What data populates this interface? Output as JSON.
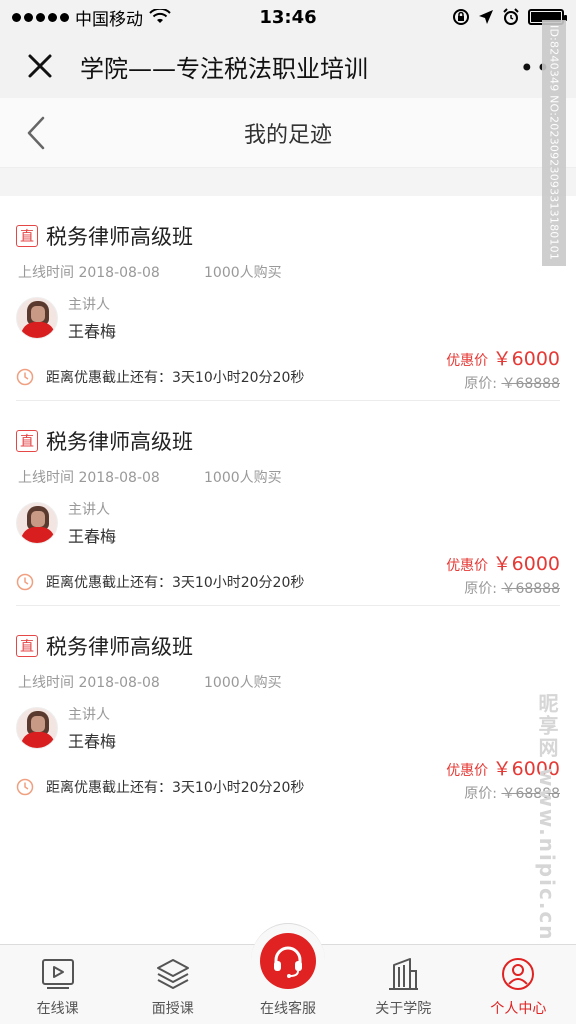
{
  "status_bar": {
    "carrier": "中国移动",
    "time": "13:46"
  },
  "nav": {
    "title": "学院——专注税法职业培训",
    "more": "••"
  },
  "page": {
    "title": "我的足迹"
  },
  "courses": [
    {
      "tag": "直",
      "title": "税务律师高级班",
      "date": "上线时间 2018-08-08",
      "buyers": "1000人购买",
      "teacher_label": "主讲人",
      "teacher_name": "王春梅",
      "sale_label": "优惠价",
      "sale_price": "￥6000",
      "orig_label": "原价:",
      "orig_price": "￥68888",
      "countdown": "距离优惠截止还有：3天10小时20分20秒"
    },
    {
      "tag": "直",
      "title": "税务律师高级班",
      "date": "上线时间 2018-08-08",
      "buyers": "1000人购买",
      "teacher_label": "主讲人",
      "teacher_name": "王春梅",
      "sale_label": "优惠价",
      "sale_price": "￥6000",
      "orig_label": "原价:",
      "orig_price": "￥68888",
      "countdown": "距离优惠截止还有：3天10小时20分20秒"
    },
    {
      "tag": "直",
      "title": "税务律师高级班",
      "date": "上线时间 2018-08-08",
      "buyers": "1000人购买",
      "teacher_label": "主讲人",
      "teacher_name": "王春梅",
      "sale_label": "优惠价",
      "sale_price": "￥6000",
      "orig_label": "原价:",
      "orig_price": "￥68888",
      "countdown": "距离优惠截止还有：3天10小时20分20秒"
    }
  ],
  "tabs": [
    {
      "label": "在线课",
      "icon": "play-video-icon"
    },
    {
      "label": "面授课",
      "icon": "layers-icon"
    },
    {
      "label": "在线客服",
      "icon": "headset-icon"
    },
    {
      "label": "关于学院",
      "icon": "building-icon"
    },
    {
      "label": "个人中心",
      "icon": "user-icon",
      "active": true
    }
  ],
  "watermark": {
    "id_text": "ID:8240349 NO:20230923093313180101",
    "logo_text": "昵享网 www.nipic.cn"
  },
  "colors": {
    "accent": "#e02222",
    "price": "#e53935",
    "tag": "#e54646",
    "clock": "#f0a080"
  }
}
